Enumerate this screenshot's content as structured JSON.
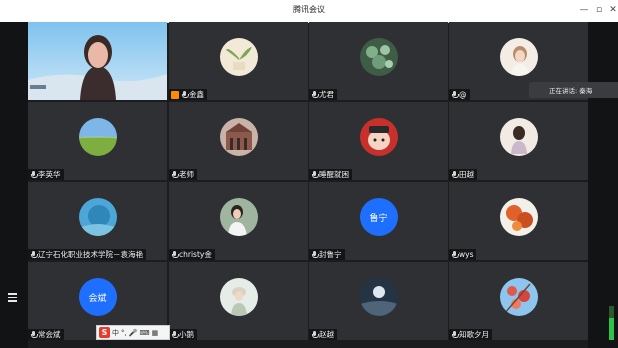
{
  "app": {
    "title": "腾讯会议"
  },
  "window_controls": {
    "minimize": "—",
    "maximize": "▫",
    "close": "✕"
  },
  "speaking": {
    "label": "正在讲话: 秦海"
  },
  "ime": {
    "mode": "中",
    "logo": "S"
  },
  "participants": [
    {
      "name": "",
      "type": "video"
    },
    {
      "name": "金鑫",
      "type": "photo",
      "host": true
    },
    {
      "name": "尤君",
      "type": "photo"
    },
    {
      "name": "@",
      "type": "photo"
    },
    {
      "name": "李英华",
      "type": "photo"
    },
    {
      "name": "老师",
      "type": "photo"
    },
    {
      "name": "睡醒就困",
      "type": "photo"
    },
    {
      "name": "田越",
      "type": "photo"
    },
    {
      "name": "辽宁石化职业技术学院－袁海艳",
      "type": "photo"
    },
    {
      "name": "christy金",
      "type": "photo"
    },
    {
      "name": "封鲁宁",
      "type": "text",
      "avatar_text": "鲁宁"
    },
    {
      "name": "wys",
      "type": "photo"
    },
    {
      "name": "常会斌",
      "type": "text",
      "avatar_text": "会斌"
    },
    {
      "name": "小鹅",
      "type": "photo"
    },
    {
      "name": "赵越",
      "type": "photo"
    },
    {
      "name": "知歌夕月",
      "type": "photo"
    }
  ],
  "colors": {
    "tile": "#2e3034",
    "accent_avatar": "#1f6fff",
    "host_badge": "#ff8a00"
  }
}
